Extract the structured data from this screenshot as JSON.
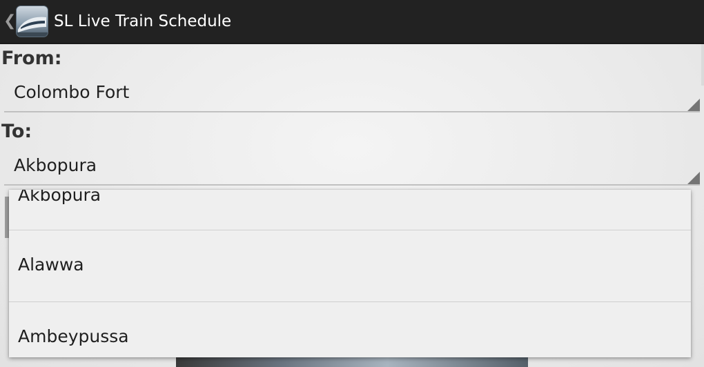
{
  "action_bar": {
    "title": "SL Live Train Schedule",
    "up_icon": "chevron-left-icon",
    "app_icon": "train-app-icon"
  },
  "form": {
    "from_label": "From:",
    "from_value": "Colombo Fort",
    "to_label": "To:",
    "to_value": "Akbopura"
  },
  "dropdown": {
    "items": [
      "Akbopura",
      "Alawwa",
      "Ambeypussa"
    ]
  }
}
